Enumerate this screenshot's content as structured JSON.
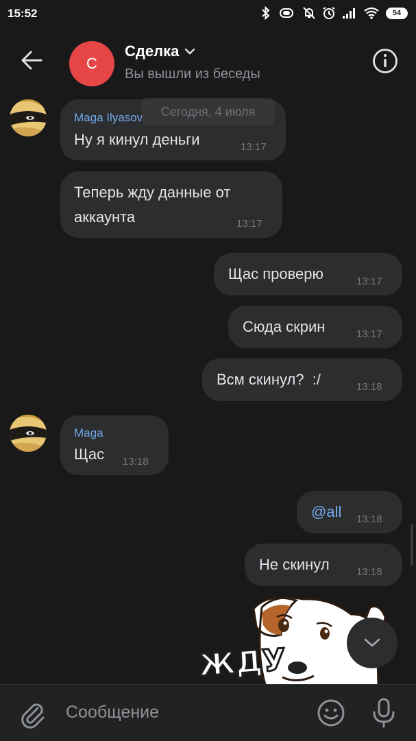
{
  "status_bar": {
    "time": "15:52",
    "battery": "54"
  },
  "header": {
    "avatar_letter": "С",
    "title": "Сделка",
    "subtitle": "Вы вышли из беседы"
  },
  "date_divider": "Сегодня, 4 июля",
  "messages": [
    {
      "sender": "Maga Ilyasov",
      "text": "Ну я кинул деньги",
      "time": "13:17",
      "direction": "incoming"
    },
    {
      "text_line1": "Теперь жду данные от",
      "text_line2": "аккаунта",
      "time": "13:17",
      "direction": "incoming"
    },
    {
      "text": "Щас проверю",
      "time": "13:17",
      "direction": "outgoing"
    },
    {
      "text": "Сюда скрин",
      "time": "13:17",
      "direction": "outgoing"
    },
    {
      "text": "Всм скинул?  :/",
      "time": "13:18",
      "direction": "outgoing"
    },
    {
      "sender": "Maga",
      "text": "Щас",
      "time": "13:18",
      "direction": "incoming"
    },
    {
      "text": "@all",
      "time": "13:18",
      "direction": "outgoing",
      "mention": true
    },
    {
      "text": "Не скинул",
      "time": "13:18",
      "direction": "outgoing"
    }
  ],
  "sticker": {
    "text": "ЖДУ"
  },
  "composer": {
    "placeholder": "Сообщение"
  },
  "colors": {
    "background": "#19191a",
    "bubble": "#2c2d2e",
    "accent": "#71aaeb",
    "chat_avatar": "#e64646"
  },
  "icons": [
    "back-arrow-icon",
    "chevron-down-icon",
    "info-icon",
    "chevron-down-icon",
    "paperclip-icon",
    "smile-icon",
    "microphone-icon"
  ]
}
